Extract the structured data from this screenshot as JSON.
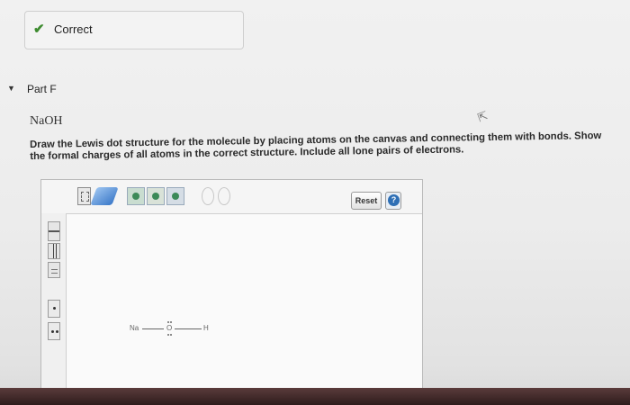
{
  "feedback": {
    "icon": "check-icon",
    "label": "Correct",
    "color": "#3d8b2f"
  },
  "part": {
    "title": "Part F",
    "icon": "triangle-down-icon"
  },
  "question": {
    "formula": "NaOH",
    "instructions": "Draw the Lewis dot structure for the molecule by placing atoms on the canvas and connecting them with bonds. Show the formal charges of all atoms in the correct structure. Include all lone pairs of electrons."
  },
  "editor": {
    "toolbar": {
      "tools": [
        "select-tool-icon",
        "eraser-tool-icon",
        "atom-template-icon",
        "atom-template-icon",
        "atom-template-icon",
        "zoom-in-icon",
        "zoom-out-icon"
      ],
      "reset_label": "Reset",
      "help_label": "?"
    },
    "sidebar_tools": [
      "single-bond-icon",
      "double-bond-icon",
      "triple-bond-icon",
      "lone-pair-icon",
      "charge-icon"
    ],
    "molecule": {
      "atoms": [
        "Na",
        "O",
        "H"
      ]
    }
  }
}
